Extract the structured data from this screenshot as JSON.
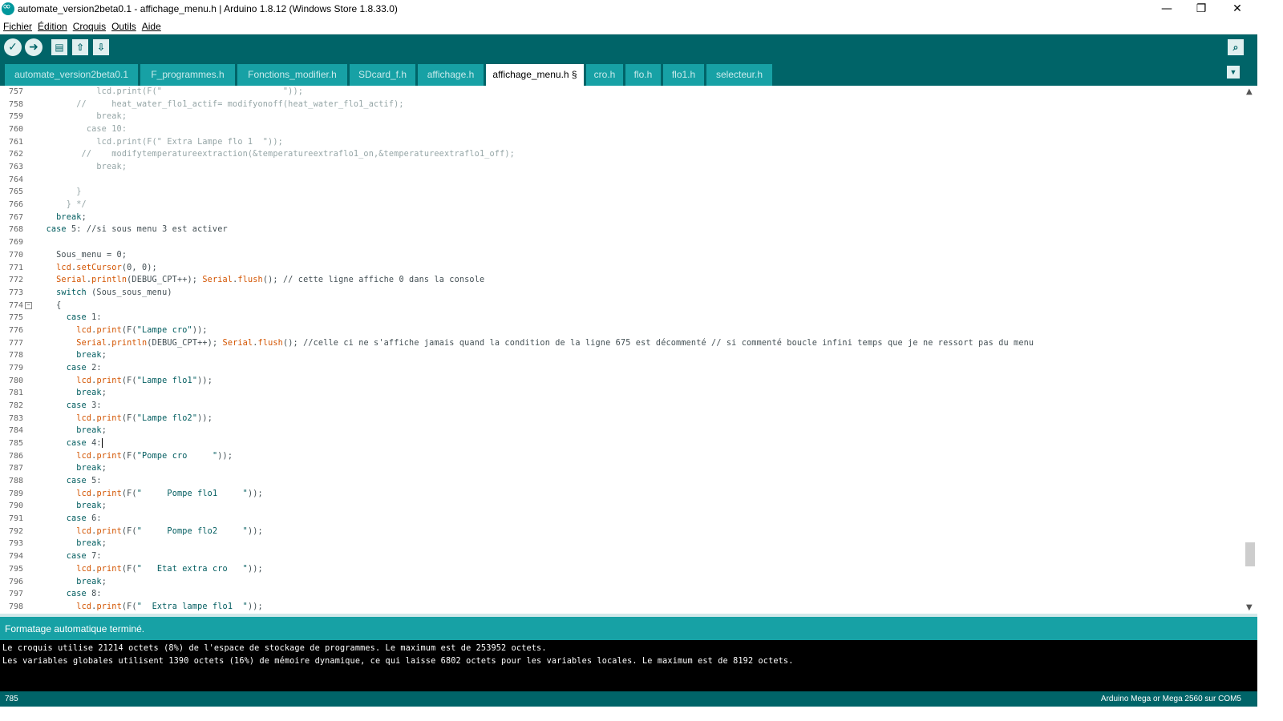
{
  "window": {
    "title": "automate_version2beta0.1 - affichage_menu.h | Arduino 1.8.12 (Windows Store 1.8.33.0)",
    "minimize": "—",
    "maximize": "❐",
    "close": "✕"
  },
  "menu": [
    "Fichier",
    "Édition",
    "Croquis",
    "Outils",
    "Aide"
  ],
  "toolbar": {
    "verify_icon": "check-icon",
    "upload_icon": "arrow-right-icon",
    "new_icon": "new-file-icon",
    "open_icon": "open-arrow-up-icon",
    "save_icon": "save-arrow-down-icon",
    "monitor_icon": "serial-monitor-icon"
  },
  "tabs": [
    {
      "label": "automate_version2beta0.1",
      "active": false
    },
    {
      "label": "F_programmes.h",
      "active": false
    },
    {
      "label": "Fonctions_modifier.h",
      "active": false
    },
    {
      "label": "SDcard_f.h",
      "active": false
    },
    {
      "label": "affichage.h",
      "active": false
    },
    {
      "label": "affichage_menu.h §",
      "active": true
    },
    {
      "label": "cro.h",
      "active": false
    },
    {
      "label": "flo.h",
      "active": false
    },
    {
      "label": "flo1.h",
      "active": false
    },
    {
      "label": "selecteur.h",
      "active": false
    }
  ],
  "editor": {
    "line_numbers": [
      "757",
      "758",
      "759",
      "760",
      "761",
      "762",
      "763",
      "764",
      "765",
      "766",
      "767",
      "768",
      "769",
      "770",
      "771",
      "772",
      "773",
      "774",
      "775",
      "776",
      "777",
      "778",
      "779",
      "780",
      "781",
      "782",
      "783",
      "784",
      "785",
      "786",
      "787",
      "788",
      "789",
      "790",
      "791",
      "792",
      "793",
      "794",
      "795",
      "796",
      "797",
      "798"
    ],
    "fold_marker": "−"
  },
  "status": {
    "message": "Formatage automatique terminé."
  },
  "console": [
    "Le croquis utilise 21214 octets (8%) de l'espace de stockage de programmes. Le maximum est de 253952 octets.",
    "Les variables globales utilisent 1390 octets (16%) de mémoire dynamique, ce qui laisse 6802 octets pour les variables locales. Le maximum est de 8192 octets."
  ],
  "footer": {
    "line": "785",
    "board": "Arduino Mega or Mega 2560 sur COM5"
  },
  "colors": {
    "toolbar": "#006468",
    "tab": "#17a1a5",
    "status": "#17a1a5",
    "console": "#000000",
    "keyword_orange": "#d35400",
    "keyword_teal": "#00979c"
  }
}
